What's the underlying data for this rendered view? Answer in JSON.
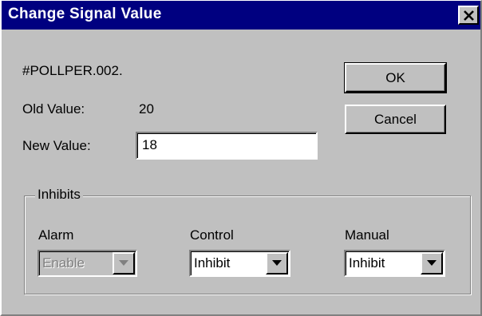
{
  "window": {
    "title": "Change Signal Value",
    "close_glyph": "×"
  },
  "signal": {
    "name": "#POLLPER.002.",
    "old_value_label": "Old Value:",
    "old_value": "20",
    "new_value_label": "New Value:",
    "new_value": "18"
  },
  "buttons": {
    "ok_label": "OK",
    "cancel_label": "Cancel"
  },
  "inhibits": {
    "group_label": "Inhibits",
    "alarm": {
      "label": "Alarm",
      "value": "Enable",
      "disabled": true
    },
    "control": {
      "label": "Control",
      "value": "Inhibit",
      "disabled": false
    },
    "manual": {
      "label": "Manual",
      "value": "Inhibit",
      "disabled": false
    }
  },
  "colors": {
    "titlebar": "#000080",
    "face": "#c0c0c0",
    "disabled_text": "#808080"
  },
  "icons": {
    "close": "close-icon",
    "dropdown": "chevron-down-icon"
  }
}
